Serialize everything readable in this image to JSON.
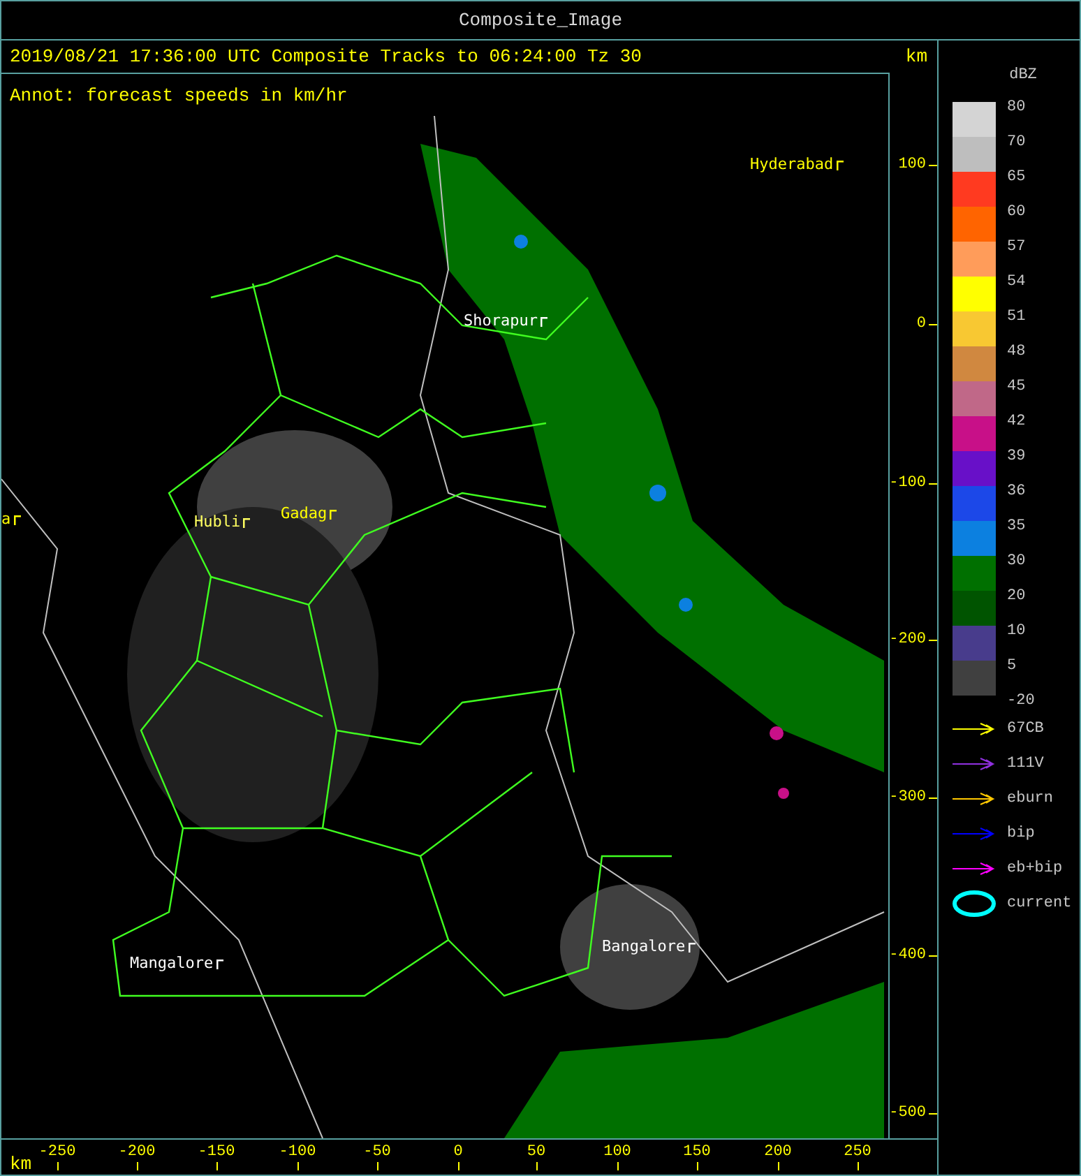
{
  "window": {
    "title": "Composite_Image"
  },
  "header": {
    "caption": "2019/08/21 17:36:00 UTC Composite Tracks to 06:24:00 Tz 30",
    "unit": "km"
  },
  "map": {
    "annotation": "Annot: forecast speeds in km/hr",
    "places": [
      {
        "name": "Hyderabad",
        "color": "#ffff00"
      },
      {
        "name": "Shorapur",
        "color": "#ffffff"
      },
      {
        "name": "a",
        "color": "#ffff00"
      },
      {
        "name": "Hubli",
        "color": "#ffff60"
      },
      {
        "name": "Gadag",
        "color": "#ffff00"
      },
      {
        "name": "Mangalore",
        "color": "#ffffff"
      },
      {
        "name": "Bangalore",
        "color": "#ffffff"
      }
    ]
  },
  "y_axis": {
    "ticks": [
      "100",
      "0",
      "-100",
      "-200",
      "-300",
      "-400",
      "-500"
    ]
  },
  "x_axis": {
    "unit": "km",
    "ticks": [
      "-250",
      "-200",
      "-150",
      "-100",
      "-50",
      "0",
      "50",
      "100",
      "150",
      "200",
      "250"
    ]
  },
  "legend": {
    "unit": "dBZ",
    "scale": [
      {
        "label": "80",
        "color": "#d4d4d4"
      },
      {
        "label": "70",
        "color": "#bebebe"
      },
      {
        "label": "65",
        "color": "#ff3a20"
      },
      {
        "label": "60",
        "color": "#ff6400"
      },
      {
        "label": "57",
        "color": "#ff9c5a"
      },
      {
        "label": "54",
        "color": "#ffff00"
      },
      {
        "label": "51",
        "color": "#f8c832"
      },
      {
        "label": "48",
        "color": "#d08840"
      },
      {
        "label": "45",
        "color": "#c06888"
      },
      {
        "label": "42",
        "color": "#c81088"
      },
      {
        "label": "39",
        "color": "#6810c8"
      },
      {
        "label": "36",
        "color": "#1c48e8"
      },
      {
        "label": "35",
        "color": "#0c80e0"
      },
      {
        "label": "30",
        "color": "#007000"
      },
      {
        "label": "20",
        "color": "#005400"
      },
      {
        "label": "10",
        "color": "#483c8c"
      },
      {
        "label": "5",
        "color": "#404040"
      }
    ],
    "bottom_label": "-20",
    "tracks": [
      {
        "label": "67CB",
        "kind": "arrow",
        "color": "#ffff00"
      },
      {
        "label": "111V",
        "kind": "arrow",
        "color": "#9030e0"
      },
      {
        "label": "eburn",
        "kind": "arrow",
        "color": "#ffc800"
      },
      {
        "label": "bip",
        "kind": "arrow",
        "color": "#0000ff"
      },
      {
        "label": "eb+bip",
        "kind": "arrow",
        "color": "#ff00ff"
      },
      {
        "label": "current",
        "kind": "ellipse",
        "color": "#00ffff"
      }
    ]
  }
}
